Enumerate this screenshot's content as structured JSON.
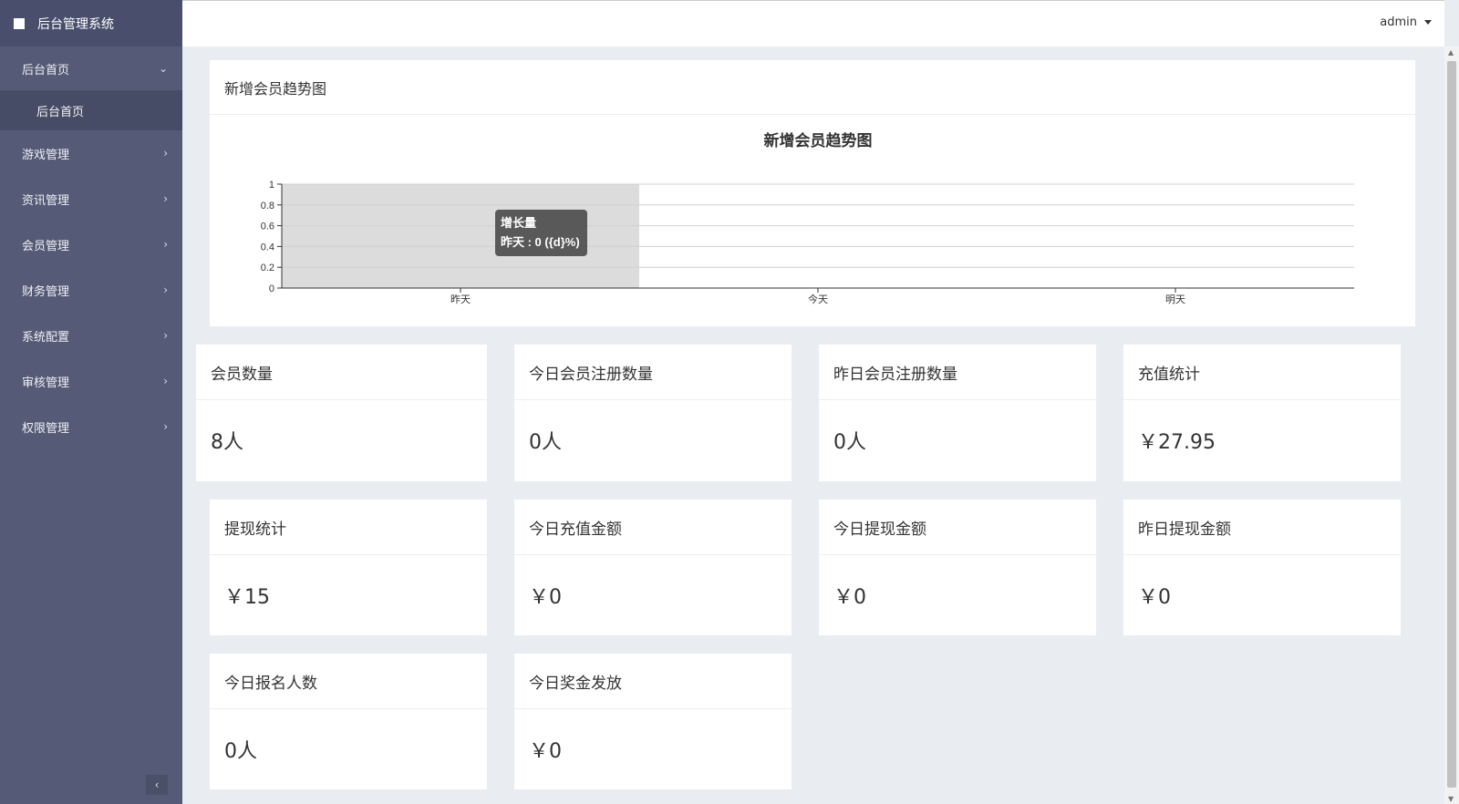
{
  "app": {
    "brand": "后台管理系统"
  },
  "sidebar": {
    "open_group": {
      "label": "后台首页",
      "sub_label": "后台首页"
    },
    "items": [
      {
        "label": "游戏管理"
      },
      {
        "label": "资讯管理"
      },
      {
        "label": "会员管理"
      },
      {
        "label": "财务管理"
      },
      {
        "label": "系统配置"
      },
      {
        "label": "审核管理"
      },
      {
        "label": "权限管理"
      }
    ],
    "collapse_icon": "‹"
  },
  "header": {
    "user": "admin"
  },
  "chart_card": {
    "title": "新增会员趋势图"
  },
  "chart_data": {
    "type": "bar",
    "title": "新增会员趋势图",
    "categories": [
      "昨天",
      "今天",
      "明天"
    ],
    "series": [
      {
        "name": "增长量",
        "values": [
          0,
          0,
          0
        ]
      }
    ],
    "ylim": [
      0,
      1
    ],
    "yticks": [
      "0",
      "0.2",
      "0.4",
      "0.6",
      "0.8",
      "1"
    ],
    "grid": true,
    "tooltip": {
      "series": "增长量",
      "text": "昨天 : 0 ({d}%)",
      "category_index": 0
    },
    "colors": {
      "highlight": "#dcdcdc",
      "tooltip_bg": "#4d4d4d",
      "grid": "#d0d0d0"
    }
  },
  "stats": [
    {
      "title": "会员数量",
      "value": "8人"
    },
    {
      "title": "今日会员注册数量",
      "value": "0人"
    },
    {
      "title": "昨日会员注册数量",
      "value": "0人"
    },
    {
      "title": "充值统计",
      "value": "￥27.95"
    },
    {
      "title": "提现统计",
      "value": "￥15"
    },
    {
      "title": "今日充值金额",
      "value": "￥0"
    },
    {
      "title": "今日提现金额",
      "value": "￥0"
    },
    {
      "title": "昨日提现金额",
      "value": "￥0"
    },
    {
      "title": "今日报名人数",
      "value": "0人"
    },
    {
      "title": "今日奖金发放",
      "value": "￥0"
    }
  ]
}
